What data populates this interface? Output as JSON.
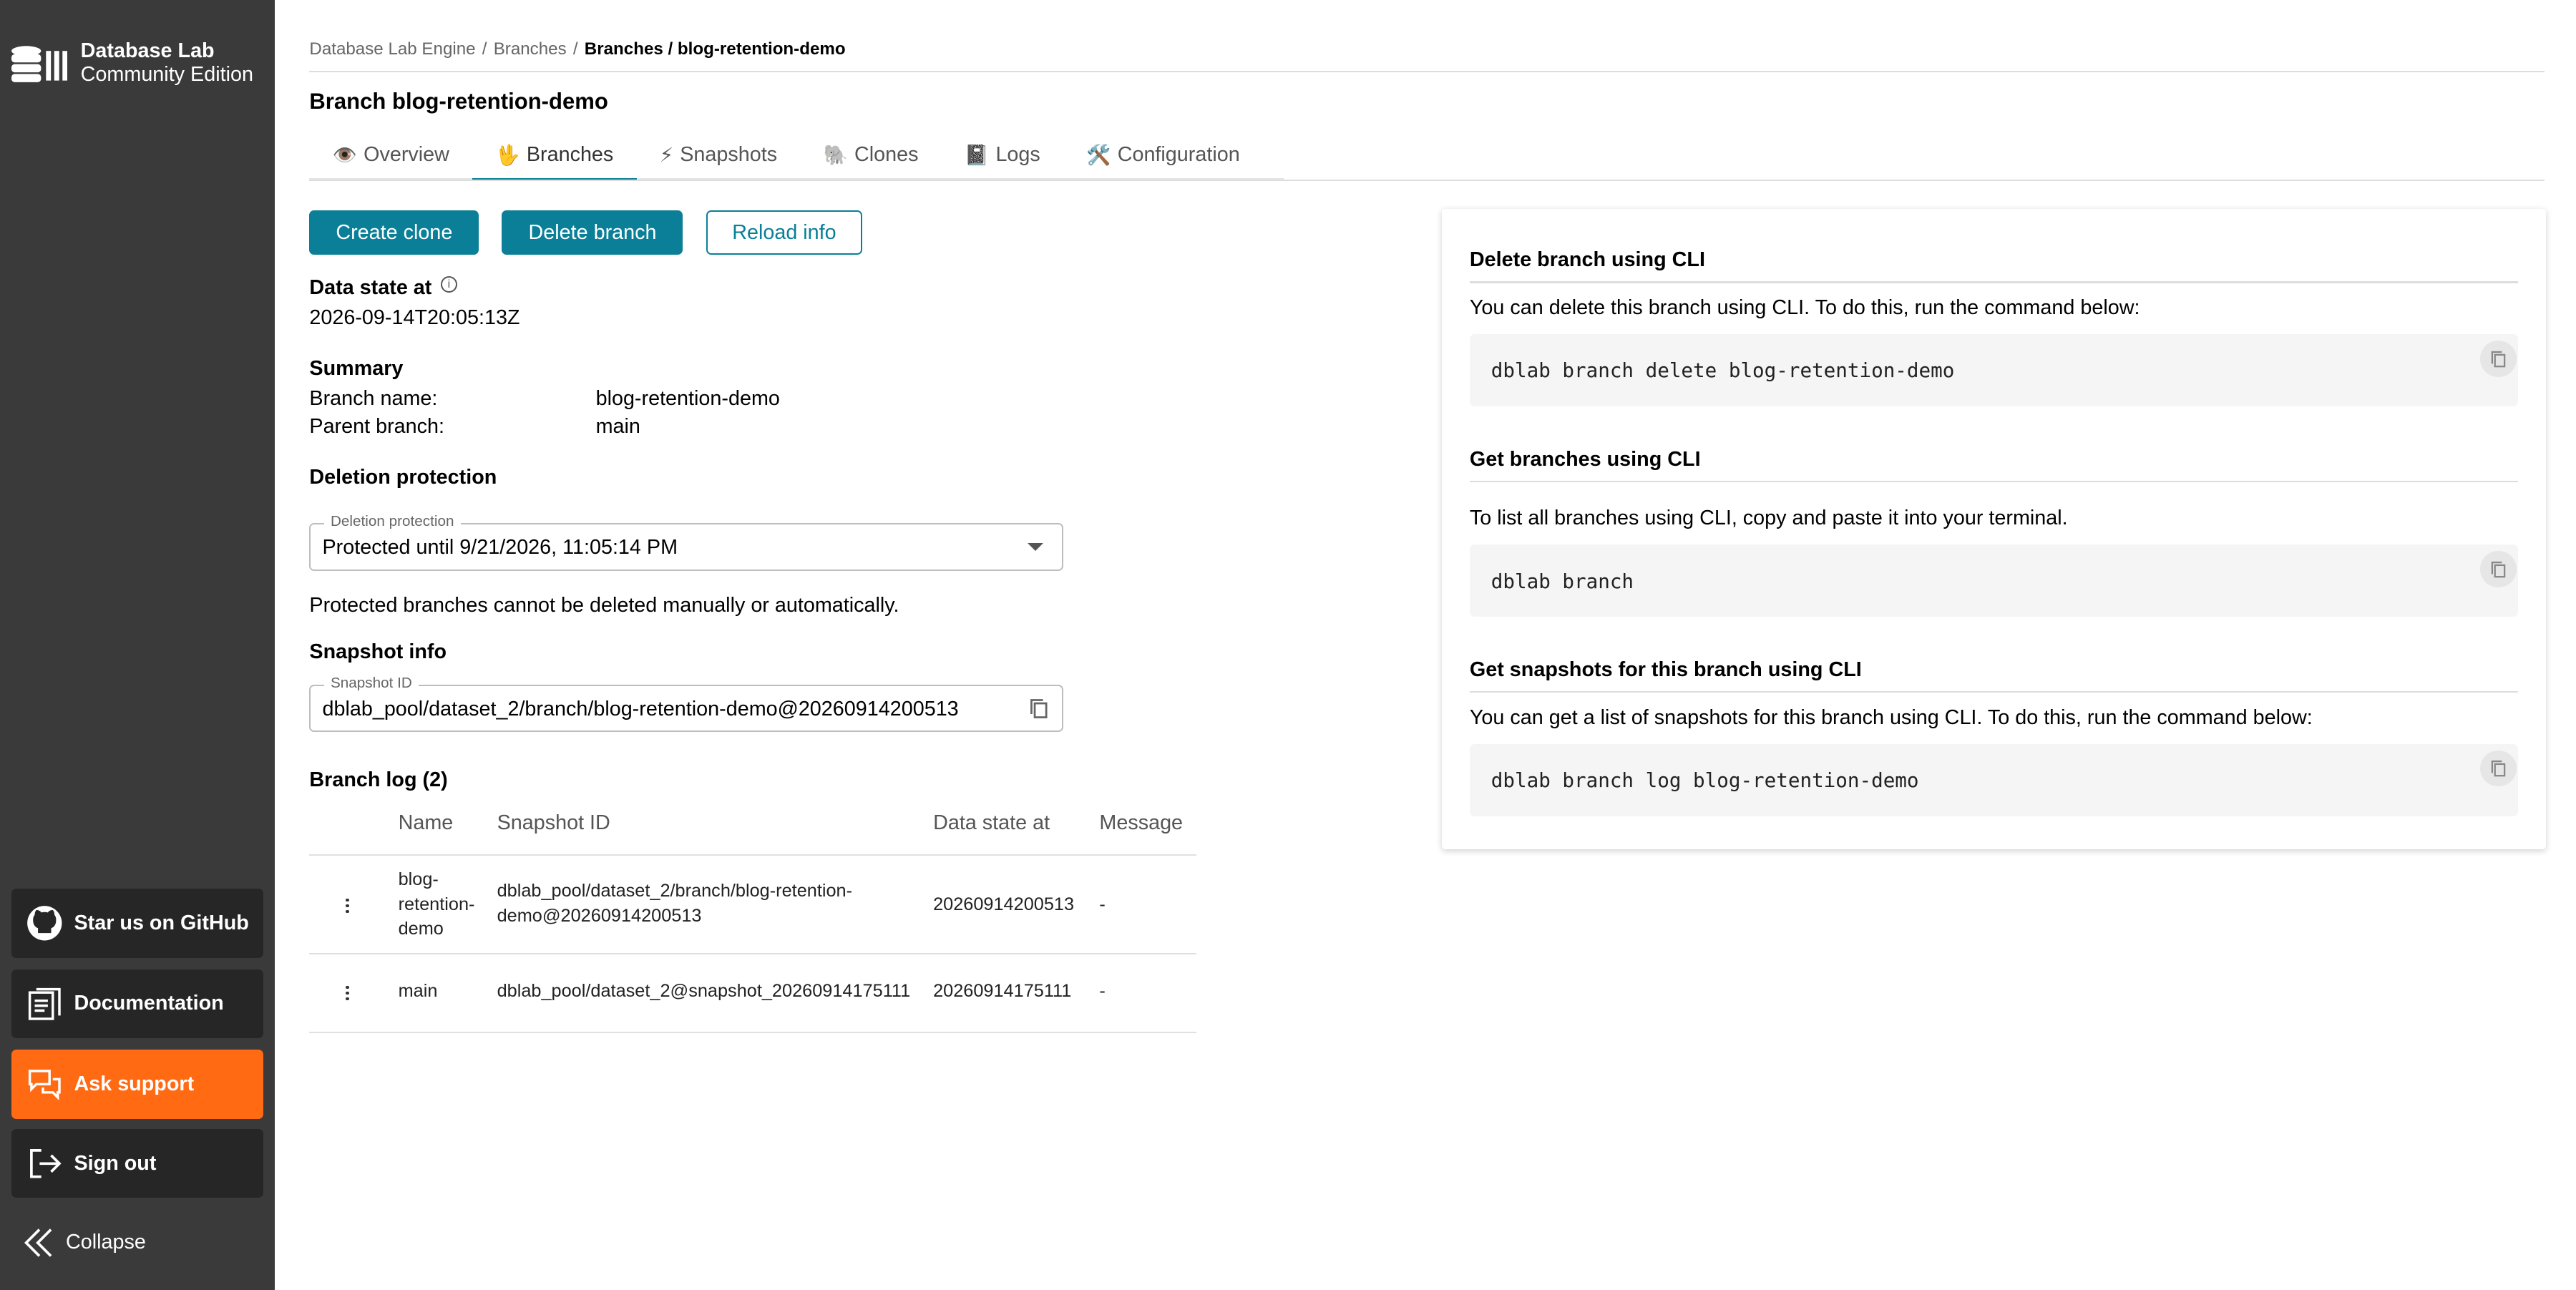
{
  "sidebar": {
    "brand_line1": "Database Lab",
    "brand_line2": "Community Edition",
    "star_label": "Star us on GitHub",
    "docs_label": "Documentation",
    "support_label": "Ask support",
    "signout_label": "Sign out",
    "collapse_label": "Collapse"
  },
  "breadcrumb": {
    "root": "Database Lab Engine",
    "branches": "Branches",
    "sep": "/",
    "current": "Branches / blog-retention-demo"
  },
  "page_title": "Branch blog-retention-demo",
  "tabs": [
    {
      "icon": "👁️",
      "label": "Overview"
    },
    {
      "icon": "🖖",
      "label": "Branches"
    },
    {
      "icon": "⚡",
      "label": "Snapshots"
    },
    {
      "icon": "🐘",
      "label": "Clones"
    },
    {
      "icon": "📓",
      "label": "Logs"
    },
    {
      "icon": "🛠️",
      "label": "Configuration"
    }
  ],
  "actions": {
    "create_clone": "Create clone",
    "delete_branch": "Delete branch",
    "reload_info": "Reload info"
  },
  "data_state": {
    "label": "Data state at",
    "info_icon": "i",
    "value": "2026-09-14T20:05:13Z"
  },
  "summary": {
    "title": "Summary",
    "branch_name_label": "Branch name:",
    "branch_name_value": "blog-retention-demo",
    "parent_branch_label": "Parent branch:",
    "parent_branch_value": "main"
  },
  "deletion_protection": {
    "title": "Deletion protection",
    "field_label": "Deletion protection",
    "selected": "Protected until 9/21/2026, 11:05:14 PM",
    "note": "Protected branches cannot be deleted manually or automatically."
  },
  "snapshot_info": {
    "title": "Snapshot info",
    "field_label": "Snapshot ID",
    "value": "dblab_pool/dataset_2/branch/blog-retention-demo@20260914200513"
  },
  "branch_log": {
    "title": "Branch log (2)",
    "headers": [
      "Name",
      "Snapshot ID",
      "Data state at",
      "Message"
    ],
    "rows": [
      {
        "name_lines": [
          "blog-",
          "retention-",
          "demo"
        ],
        "snapshot_lines": [
          "dblab_pool/dataset_2/branch/blog-retention-",
          "demo@20260914200513"
        ],
        "data_state": "20260914200513",
        "message": "-"
      },
      {
        "name_lines": [
          "main"
        ],
        "snapshot_lines": [
          "dblab_pool/dataset_2@snapshot_20260914175111"
        ],
        "data_state": "20260914175111",
        "message": "-"
      }
    ]
  },
  "cli_panel": {
    "delete": {
      "title": "Delete branch using CLI",
      "desc": "You can delete this branch using CLI. To do this, run the command below:",
      "command": "dblab branch delete blog-retention-demo"
    },
    "list": {
      "title": "Get branches using CLI",
      "desc": "To list all branches using CLI, copy and paste it into your terminal.",
      "command": "dblab branch"
    },
    "snapshots": {
      "title": "Get snapshots for this branch using CLI",
      "desc": "You can get a list of snapshots for this branch using CLI. To do this, run the command below:",
      "command": "dblab branch log blog-retention-demo"
    }
  },
  "colors": {
    "accent": "#0b7f97",
    "sidebar_bg": "#3a3a3a",
    "sidebar_button": "#262626",
    "support_orange": "#ff6a13"
  }
}
